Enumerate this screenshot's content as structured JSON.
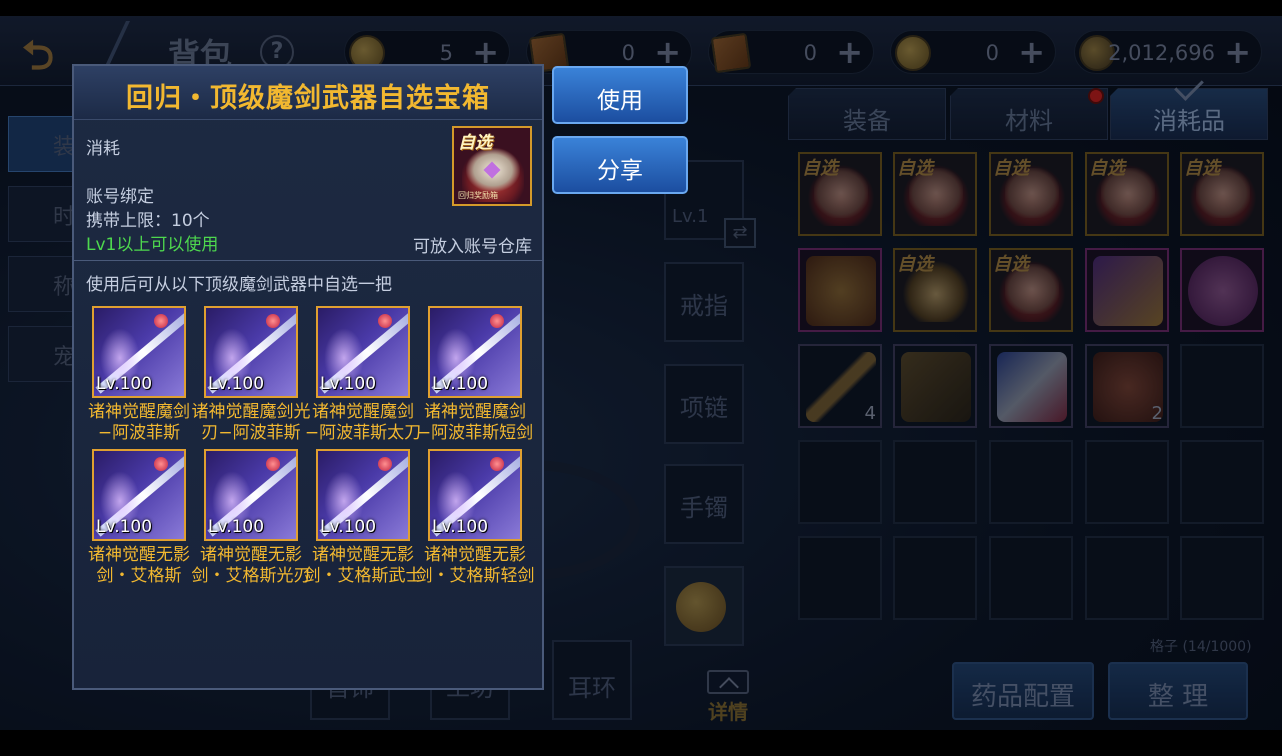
{
  "header": {
    "title": "背包",
    "help_symbol": "?",
    "currencies": [
      {
        "icon": "coin-icon",
        "value": "5"
      },
      {
        "icon": "scroll-icon",
        "value": "0"
      },
      {
        "icon": "locked-scroll-icon",
        "value": "0"
      },
      {
        "icon": "bound-coin-icon",
        "value": "0"
      },
      {
        "icon": "gold-bag-icon",
        "value": "2,012,696"
      }
    ],
    "plus_symbol": "+"
  },
  "left_menu": {
    "tabs": [
      "装",
      "时",
      "称",
      "宠"
    ]
  },
  "equipment_slots": {
    "level_badge": "Lv.1",
    "ring": "戒指",
    "necklace": "项链",
    "bracelet": "手镯",
    "earring": "耳环",
    "partial_left": "首饰",
    "partial_mid": "工坊",
    "detail_label": "详情"
  },
  "inventory": {
    "tabs": [
      {
        "label": "装备",
        "active": false
      },
      {
        "label": "材料",
        "active": false,
        "has_notification": true
      },
      {
        "label": "消耗品",
        "active": true
      }
    ],
    "select_tag": "自选",
    "stack_counts": {
      "hammer": "4",
      "beast": "2"
    },
    "slots_label": "格子 (14/1000)",
    "potion_config_label": "药品配置",
    "sort_label": "整 理"
  },
  "popup": {
    "title": "回归・顶级魔剑武器自选宝箱",
    "item_type": "消耗",
    "icon_tag": "自选",
    "icon_subtext": "回归奖励箱",
    "binding": "账号绑定",
    "carry_limit": "携带上限：10个",
    "level_requirement": "Lv1以上可以使用",
    "warehouse": "可放入账号仓库",
    "description": "使用后可从以下顶级魔剑武器中自选一把",
    "rewards": [
      {
        "level": "Lv.100",
        "name": "诸神觉醒魔剑−阿波菲斯"
      },
      {
        "level": "Lv.100",
        "name": "诸神觉醒魔剑光刃−阿波菲斯"
      },
      {
        "level": "Lv.100",
        "name": "诸神觉醒魔剑−阿波菲斯太刀"
      },
      {
        "level": "Lv.100",
        "name": "诸神觉醒魔剑−阿波菲斯短剑"
      },
      {
        "level": "Lv.100",
        "name": "诸神觉醒无影剑・艾格斯"
      },
      {
        "level": "Lv.100",
        "name": "诸神觉醒无影剑・艾格斯光刃"
      },
      {
        "level": "Lv.100",
        "name": "诸神觉醒无影剑・艾格斯武士刀"
      },
      {
        "level": "Lv.100",
        "name": "诸神觉醒无影剑・艾格斯轻剑"
      }
    ]
  },
  "actions": {
    "use_label": "使用",
    "share_label": "分享"
  },
  "colors": {
    "title_gold": "#f2b830",
    "requirement_green": "#4ed84e",
    "button_blue": "#2a66c0"
  }
}
